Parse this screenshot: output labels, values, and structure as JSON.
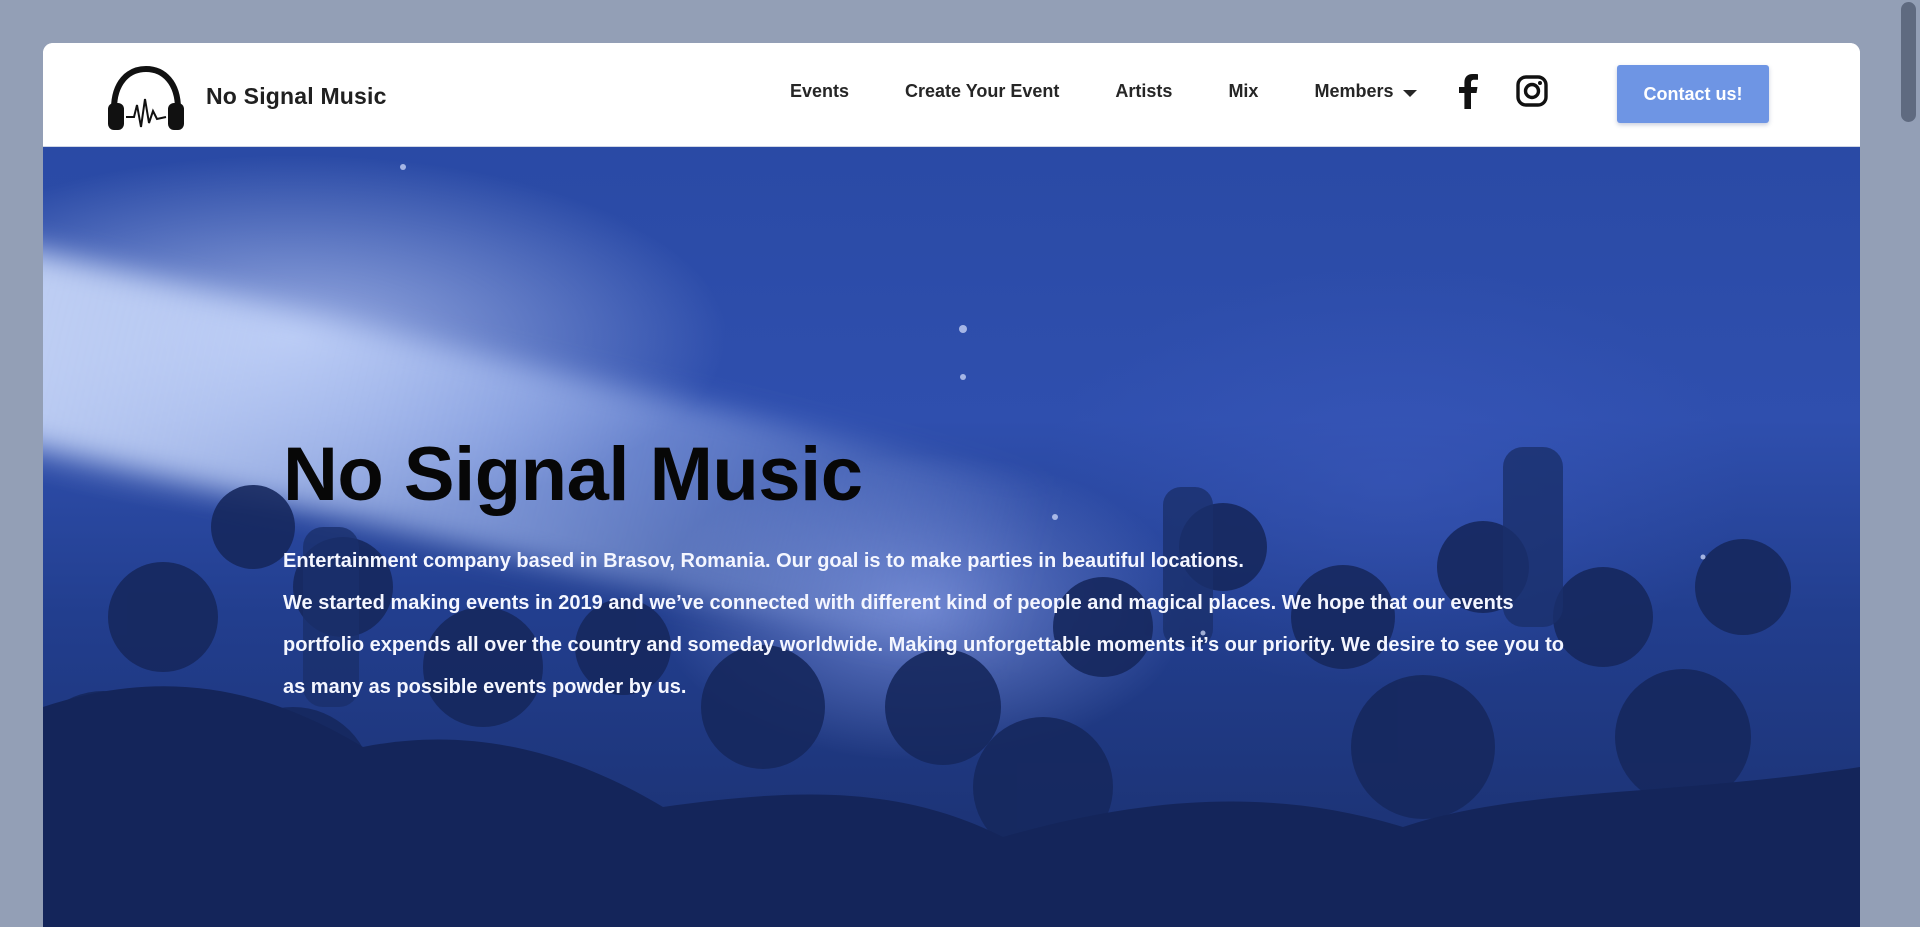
{
  "brand": {
    "name": "No Signal Music",
    "logo_icon": "headphones-icon"
  },
  "nav": {
    "items": [
      {
        "label": "Events"
      },
      {
        "label": "Create Your Event"
      },
      {
        "label": "Artists"
      },
      {
        "label": "Mix"
      },
      {
        "label": "Members",
        "has_dropdown": true
      }
    ]
  },
  "social": [
    {
      "icon": "facebook-icon"
    },
    {
      "icon": "instagram-icon"
    }
  ],
  "contact_button": {
    "label": "Contact us!"
  },
  "hero": {
    "title": "No Signal Music",
    "paragraphs": [
      "Entertainment company based in Brasov, Romania. Our goal is to make parties in beautiful locations.",
      "We started making events in 2019 and we’ve connected with different kind of people and magical places. We hope that our events portfolio expends all over the country and someday worldwide. Making unforgettable moments it’s our priority. We desire to see you to as many as possible events powder by us."
    ]
  },
  "colors": {
    "page_background": "#939fb6",
    "accent": "#6e95e4",
    "hero_blue": "#2a4aa5",
    "text_dark": "#262626"
  }
}
